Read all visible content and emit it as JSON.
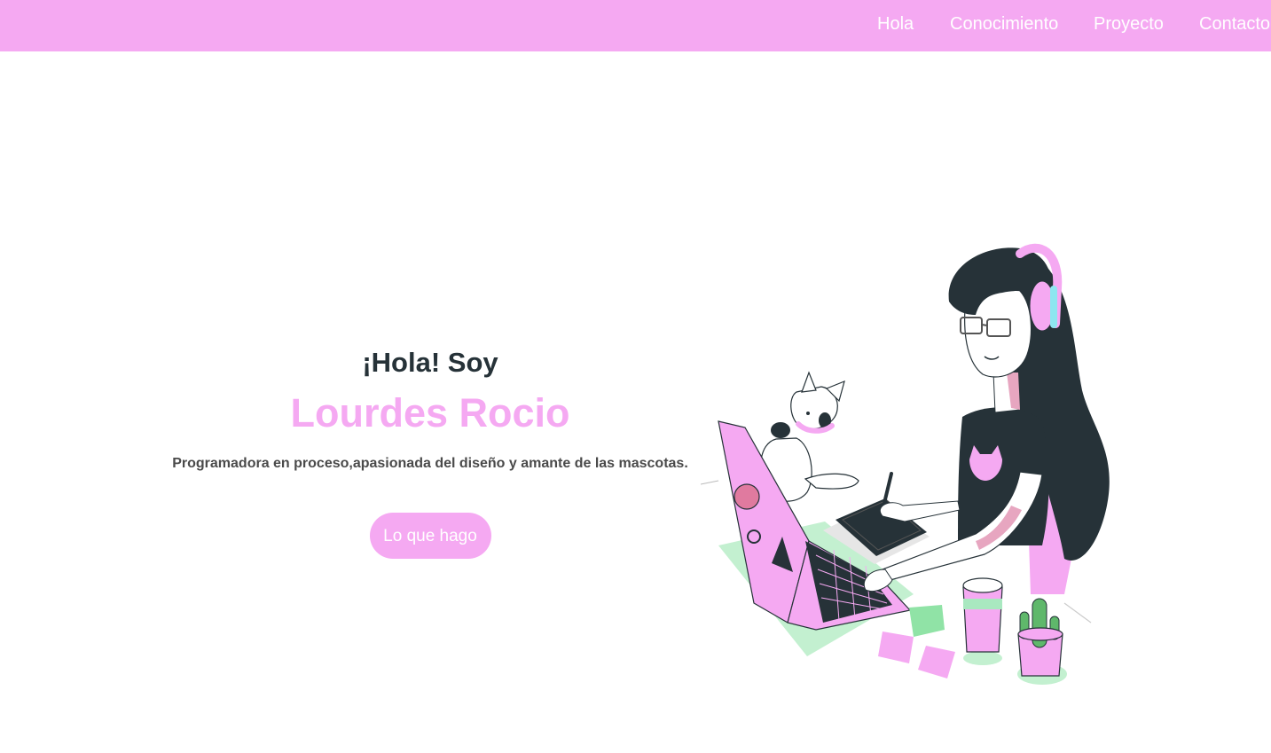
{
  "nav": {
    "items": [
      {
        "label": "Hola"
      },
      {
        "label": "Conocimiento"
      },
      {
        "label": "Proyecto"
      },
      {
        "label": "Contacto"
      }
    ]
  },
  "hero": {
    "greeting": "¡Hola! Soy",
    "name": "Lourdes Rocio",
    "tagline": "Programadora en proceso,apasionada del diseño y amante de las mascotas.",
    "button_label": "Lo que hago"
  },
  "colors": {
    "accent": "#f5a9f2",
    "dark": "#263238",
    "green": "#a9e8c0"
  }
}
